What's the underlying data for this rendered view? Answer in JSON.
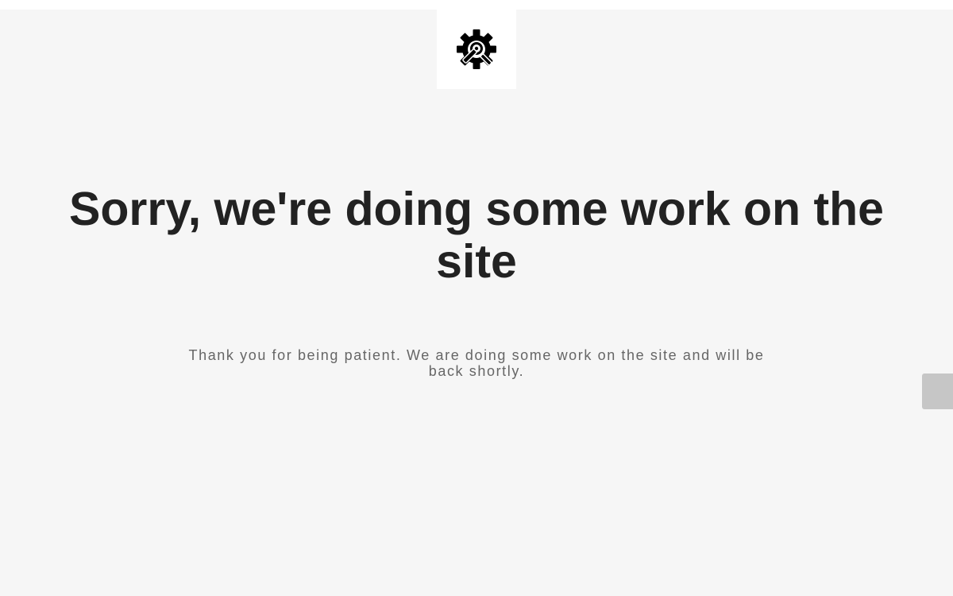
{
  "logo": {
    "icon": "gear-wrench-maintenance-icon"
  },
  "headline": "Sorry, we're doing some work on the site",
  "message": "Thank you for being patient. We are doing some work on the site and will be back shortly.",
  "colors": {
    "background": "#f6f6f6",
    "logo_box": "#ffffff",
    "headline": "#222222",
    "message": "#666666",
    "side_tab": "#c6c6c6"
  }
}
